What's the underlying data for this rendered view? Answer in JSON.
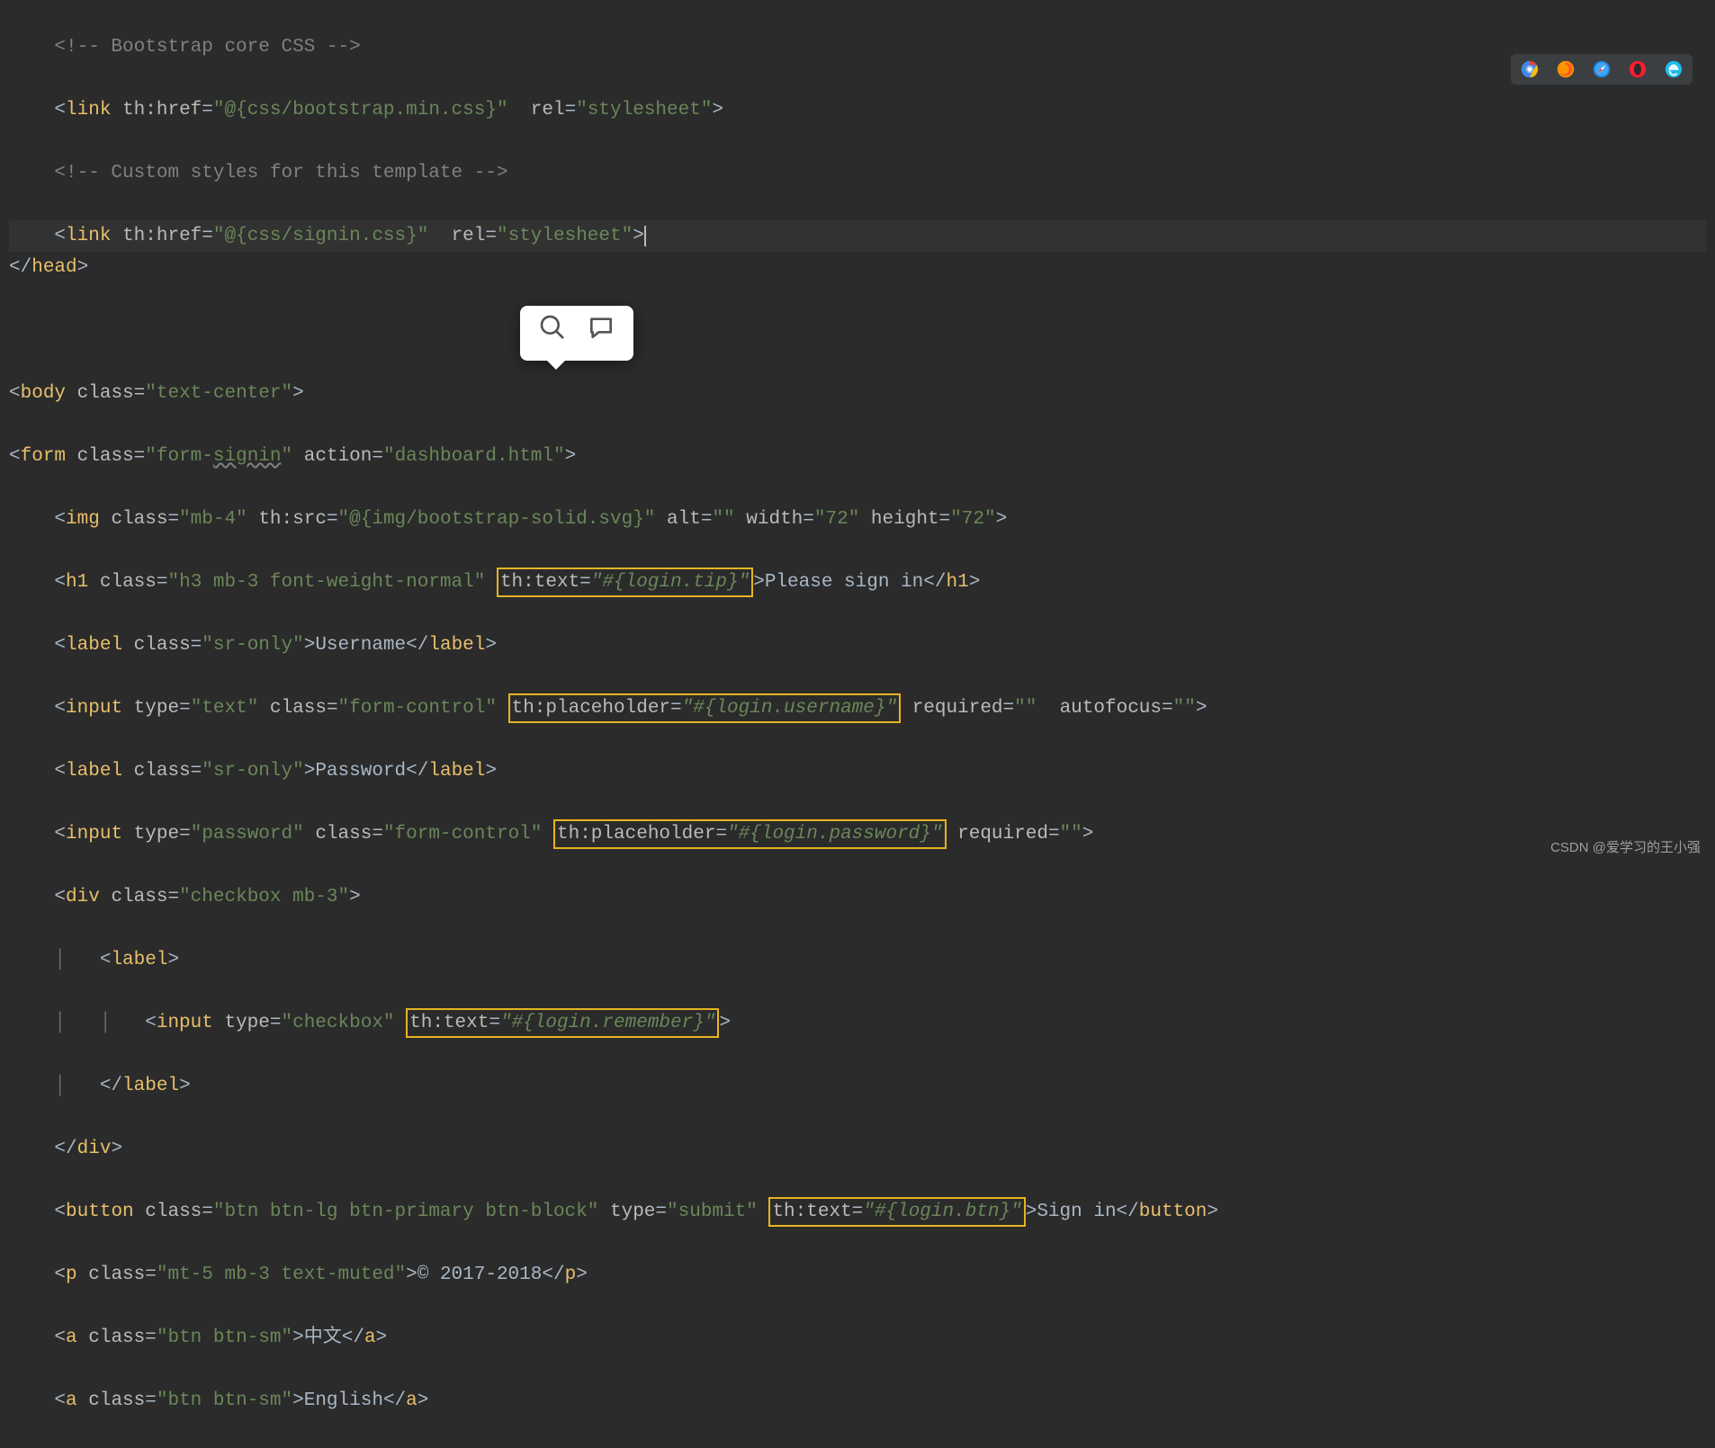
{
  "code": {
    "l1": "<!-- Bootstrap core CSS -->",
    "l2p_tag": "link",
    "l2p_attr_thhref": "th:href",
    "l2p_val_thhref": "\"@{css/bootstrap.min.css}\"",
    "l2p_attr_rel": "rel",
    "l2p_val_rel": "\"stylesheet\"",
    "l3": "<!-- Custom styles for this template -->",
    "l4_val_thhref": "\"@{css/signin.css}\"",
    "head_close": "head",
    "body_tag": "body",
    "body_class_attr": "class",
    "body_class_val": "\"text-center\"",
    "form_tag": "form",
    "form_class_val": "\"form-signin\"",
    "form_action_attr": "action",
    "form_action_val": "\"dashboard.html\"",
    "signin_wavy": "signin",
    "img_tag": "img",
    "img_class_val": "\"mb-4\"",
    "img_thsrc_attr": "th:src",
    "img_thsrc_val": "\"@{img/bootstrap-solid.svg}\"",
    "img_alt_attr": "alt",
    "img_alt_val": "\"\"",
    "img_width_attr": "width",
    "img_width_val": "\"72\"",
    "img_height_attr": "height",
    "img_height_val": "\"72\"",
    "h1_tag": "h1",
    "h1_class_val": "\"h3 mb-3 font-weight-normal\"",
    "thtext_attr": "th:text",
    "login_tip_val": "\"#{login.tip}\"",
    "please_signin": "Please sign in",
    "label_tag": "label",
    "sr_only_val": "\"sr-only\"",
    "username_text": "Username",
    "input_tag": "input",
    "type_attr": "type",
    "type_text_val": "\"text\"",
    "class_attr": "class",
    "form_control_val": "\"form-control\"",
    "thplaceholder_attr": "th:placeholder",
    "login_username_val": "\"#{login.username}\"",
    "required_attr": "required",
    "empty_val": "\"\"",
    "autofocus_attr": "autofocus",
    "password_text": "Password",
    "type_password_val": "\"password\"",
    "login_password_val": "\"#{login.password}\"",
    "div_tag": "div",
    "checkbox_class_val": "\"checkbox mb-3\"",
    "type_checkbox_val": "\"checkbox\"",
    "login_remember_val": "\"#{login.remember}\"",
    "button_tag": "button",
    "button_class_val": "\"btn btn-lg btn-primary btn-block\"",
    "type_submit_val": "\"submit\"",
    "login_btn_val": "\"#{login.btn}\"",
    "signin_text": "Sign in",
    "p_tag": "p",
    "p_class_val": "\"mt-5 mb-3 text-muted\"",
    "copyright_text": "© 2017-2018",
    "a_tag": "a",
    "a_class_val": "\"btn btn-sm\"",
    "chinese_text": "中文",
    "english_text": "English"
  },
  "watermark": "CSDN @爱学习的王小强"
}
